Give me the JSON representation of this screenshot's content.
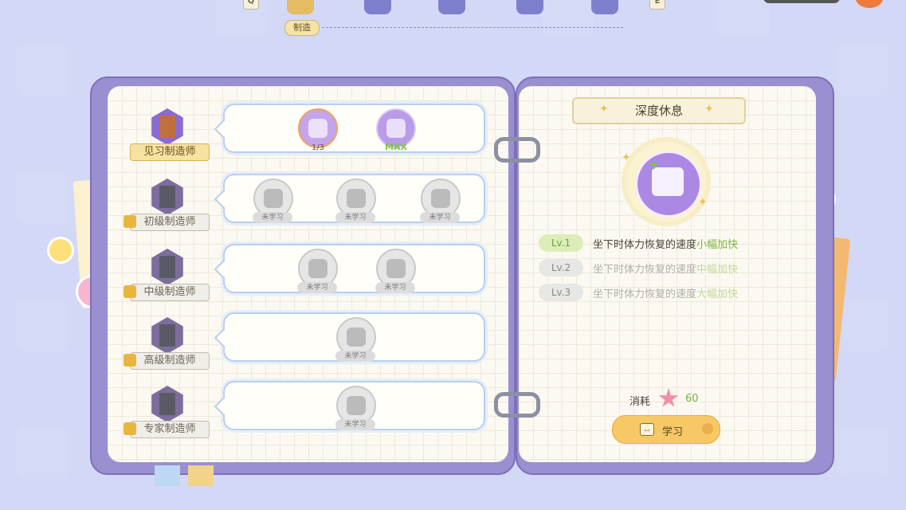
{
  "top_nav": {
    "left_key": "Q",
    "right_key": "E",
    "active_tab_label": "制造",
    "tabs": [
      {
        "icon": "hammer-icon",
        "active": true
      },
      {
        "icon": "figure-icon",
        "active": false
      },
      {
        "icon": "tree-icon",
        "active": false
      },
      {
        "icon": "pig-icon",
        "active": false
      },
      {
        "icon": "bird-icon",
        "active": false
      }
    ]
  },
  "tiers": [
    {
      "name": "见习制造师",
      "locked": false,
      "icon": "hammer-icon",
      "skills": [
        {
          "icon": "bench-icon",
          "state": "learned",
          "progress": "1/3"
        },
        {
          "icon": "sparkle-icon",
          "state": "max",
          "tag": "MAX"
        }
      ]
    },
    {
      "name": "初级制造师",
      "locked": true,
      "icon": "hammer-icon",
      "skills": [
        {
          "icon": "gear-icon",
          "state": "locked",
          "tag": "未学习"
        },
        {
          "icon": "flower-icon",
          "state": "locked",
          "tag": "未学习"
        },
        {
          "icon": "mushroom-icon",
          "state": "locked",
          "tag": "未学习"
        }
      ]
    },
    {
      "name": "中级制造师",
      "locked": true,
      "icon": "hammer-icon",
      "skills": [
        {
          "icon": "ticket-icon",
          "state": "locked",
          "tag": "未学习"
        },
        {
          "icon": "muscle-icon",
          "state": "locked",
          "tag": "未学习"
        }
      ]
    },
    {
      "name": "高级制造师",
      "locked": true,
      "icon": "hammer-icon",
      "skills": [
        {
          "icon": "wand-icon",
          "state": "locked",
          "tag": "未学习"
        }
      ]
    },
    {
      "name": "专家制造师",
      "locked": true,
      "icon": "hammer-icon",
      "skills": [
        {
          "icon": "robot-icon",
          "state": "locked",
          "tag": "未学习"
        }
      ]
    }
  ],
  "detail": {
    "title": "深度休息",
    "icon": "bench-icon",
    "levels": [
      {
        "badge": "Lv.1",
        "desc": "坐下时体力恢复的速度",
        "highlight": "小幅加快",
        "active": true
      },
      {
        "badge": "Lv.2",
        "desc": "坐下时体力恢复的速度",
        "highlight": "中幅加快",
        "active": false
      },
      {
        "badge": "Lv.3",
        "desc": "坐下时体力恢复的速度",
        "highlight": "大幅加快",
        "active": false
      }
    ],
    "cost_label": "消耗",
    "cost_icon": "star-icon",
    "cost_value": "60",
    "learn_label": "学习"
  },
  "colors": {
    "background": "#c6cdf1",
    "cover": "#9a8fd0",
    "accent_green": "#7eb53c",
    "button": "#f6c866"
  }
}
